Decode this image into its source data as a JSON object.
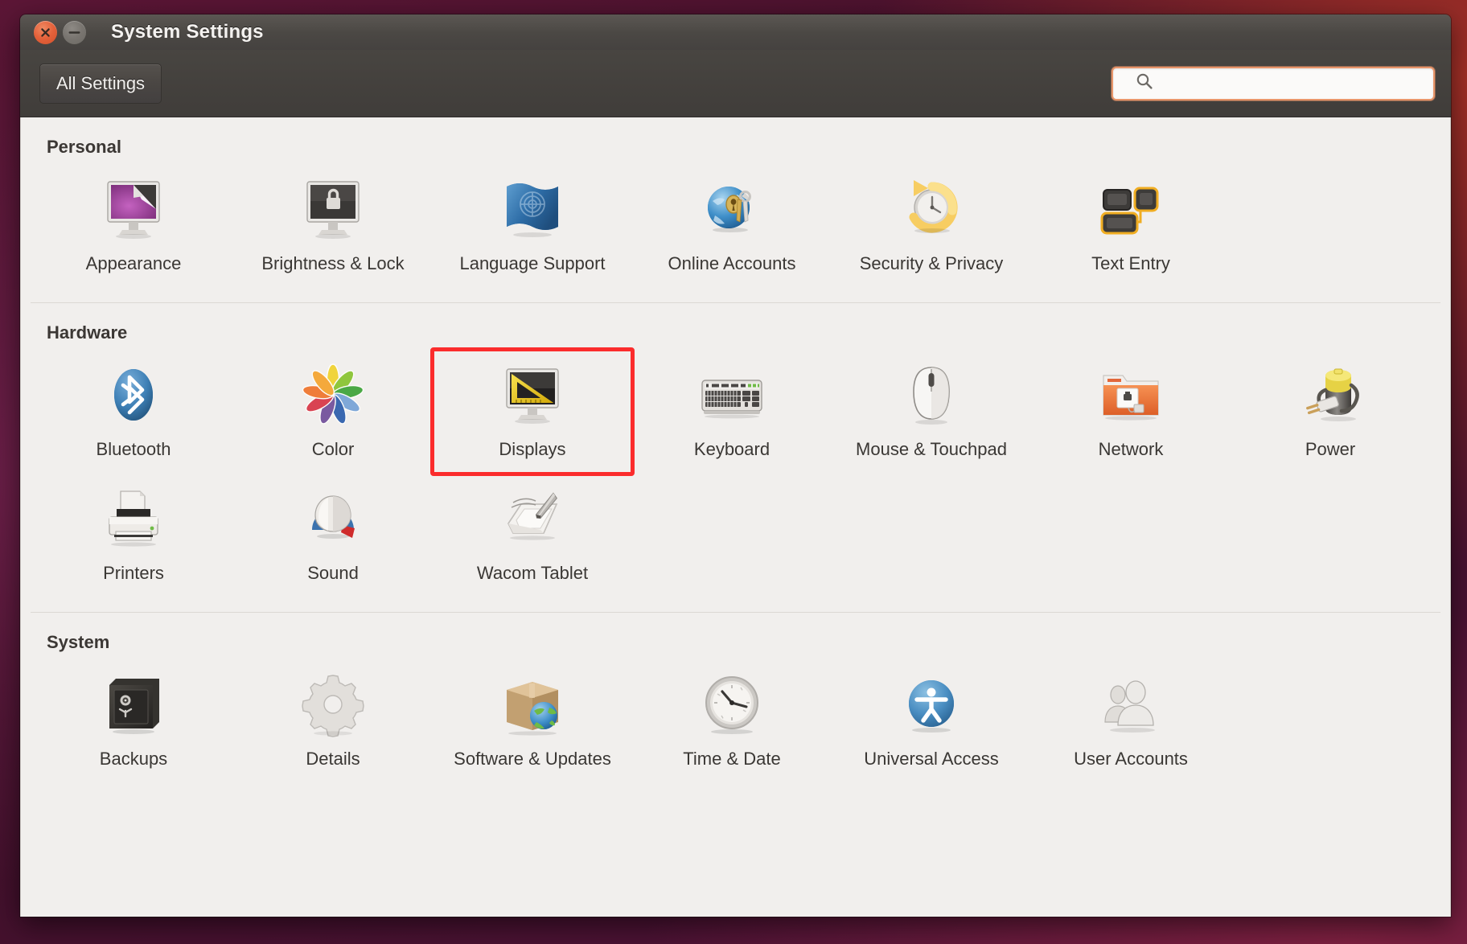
{
  "window": {
    "title": "System Settings",
    "close_icon": "close-icon",
    "minimize_icon": "minimize-icon"
  },
  "toolbar": {
    "all_settings_label": "All Settings",
    "search_icon": "search-icon",
    "search_value": "",
    "search_placeholder": ""
  },
  "sections": [
    {
      "title": "Personal",
      "items": [
        {
          "label": "Appearance",
          "icon": "appearance-icon"
        },
        {
          "label": "Brightness & Lock",
          "icon": "brightness-lock-icon"
        },
        {
          "label": "Language Support",
          "icon": "language-support-icon"
        },
        {
          "label": "Online Accounts",
          "icon": "online-accounts-icon"
        },
        {
          "label": "Security & Privacy",
          "icon": "security-privacy-icon"
        },
        {
          "label": "Text Entry",
          "icon": "text-entry-icon"
        }
      ]
    },
    {
      "title": "Hardware",
      "items": [
        {
          "label": "Bluetooth",
          "icon": "bluetooth-icon"
        },
        {
          "label": "Color",
          "icon": "color-icon"
        },
        {
          "label": "Displays",
          "icon": "displays-icon",
          "highlighted": true
        },
        {
          "label": "Keyboard",
          "icon": "keyboard-icon"
        },
        {
          "label": "Mouse & Touchpad",
          "icon": "mouse-touchpad-icon"
        },
        {
          "label": "Network",
          "icon": "network-icon"
        },
        {
          "label": "Power",
          "icon": "power-icon"
        },
        {
          "label": "Printers",
          "icon": "printers-icon"
        },
        {
          "label": "Sound",
          "icon": "sound-icon"
        },
        {
          "label": "Wacom Tablet",
          "icon": "wacom-tablet-icon"
        }
      ]
    },
    {
      "title": "System",
      "items": [
        {
          "label": "Backups",
          "icon": "backups-icon"
        },
        {
          "label": "Details",
          "icon": "details-icon"
        },
        {
          "label": "Software & Updates",
          "icon": "software-updates-icon"
        },
        {
          "label": "Time & Date",
          "icon": "time-date-icon"
        },
        {
          "label": "Universal Access",
          "icon": "universal-access-icon"
        },
        {
          "label": "User Accounts",
          "icon": "user-accounts-icon"
        }
      ]
    }
  ],
  "colors": {
    "highlight": "#fb2c2c",
    "accent_orange": "#e8956a",
    "titlebar": "#4b4844",
    "content_bg": "#f1efed"
  }
}
